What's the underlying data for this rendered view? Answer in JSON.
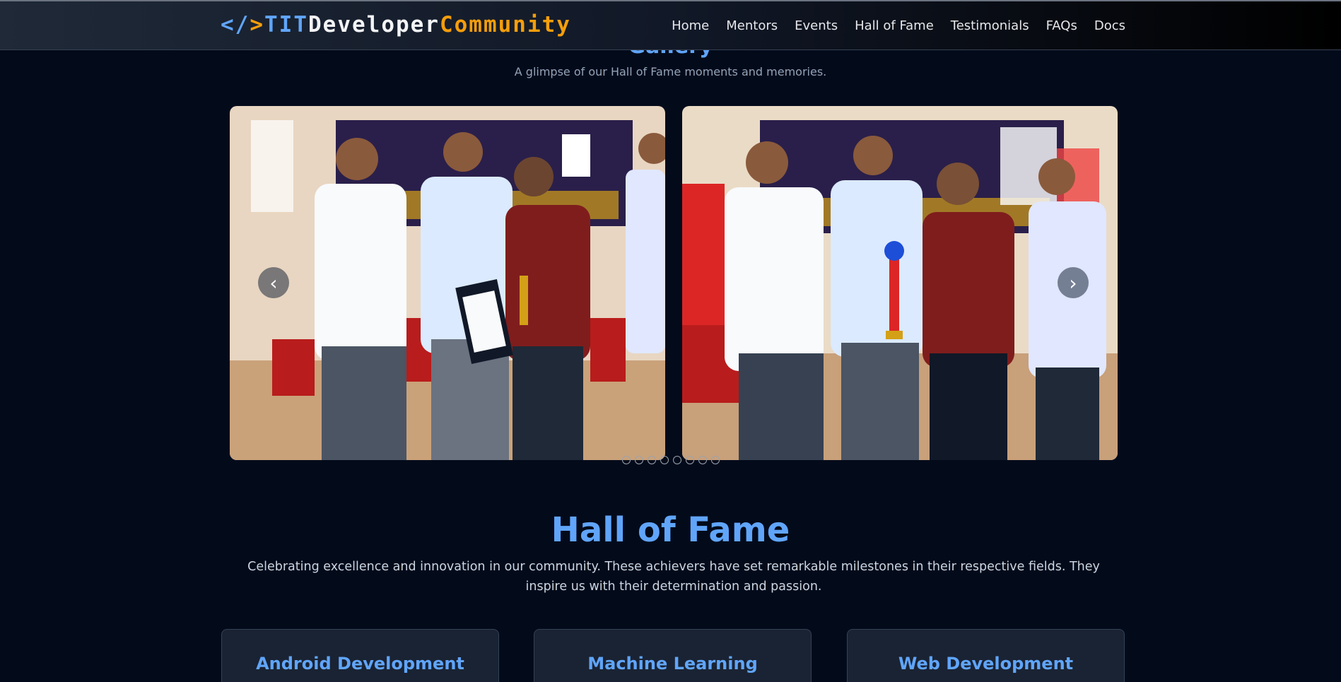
{
  "navbar": {
    "brand": {
      "open_bracket": "</",
      "close_bracket": ">",
      "tit": "TIT",
      "developer": "Developer",
      "community": "Community",
      "colors": {
        "accent_blue": "#60a5fa",
        "accent_orange": "#f59e0b",
        "white": "#f3f4f6"
      }
    },
    "links": [
      "Home",
      "Mentors",
      "Events",
      "Hall of Fame",
      "Testimonials",
      "FAQs",
      "Docs"
    ]
  },
  "gallery": {
    "title": "Gallery",
    "subtitle": "A glimpse of our Hall of Fame moments and memories.",
    "prev_icon": "chevron-left-icon",
    "next_icon": "chevron-right-icon",
    "prev_glyph": "‹",
    "next_glyph": "›",
    "dot_count": 8,
    "slides": [
      {
        "description": "Award ceremony photo: student receiving certificate and trophy"
      },
      {
        "description": "Award ceremony photo: student receiving trophy"
      }
    ]
  },
  "hall_of_fame": {
    "title": "Hall of Fame",
    "description": "Celebrating excellence and innovation in our community. These achievers have set remarkable milestones in their respective fields. They inspire us with their determination and passion.",
    "cards": [
      {
        "title": "Android Development"
      },
      {
        "title": "Machine Learning"
      },
      {
        "title": "Web Development"
      }
    ]
  }
}
